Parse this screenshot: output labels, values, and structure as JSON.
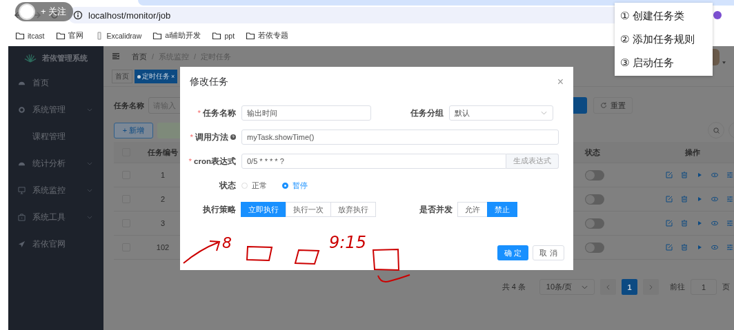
{
  "browser": {
    "url": "localhost/monitor/job",
    "bookmarks": [
      {
        "label": "itcast",
        "kind": "folder"
      },
      {
        "label": "官网",
        "kind": "folder"
      },
      {
        "label": "Excalidraw",
        "kind": "page"
      },
      {
        "label": "ai辅助开发",
        "kind": "folder"
      },
      {
        "label": "ppt",
        "kind": "folder"
      },
      {
        "label": "若依专题",
        "kind": "folder"
      }
    ]
  },
  "follow_badge": {
    "label": "+ 关注"
  },
  "popup_menu": {
    "items": [
      "① 创建任务类",
      "② 添加任务规则",
      "③ 启动任务"
    ]
  },
  "sidebar": {
    "title": "若依管理系统",
    "items": [
      {
        "label": "首页",
        "kind": "link"
      },
      {
        "label": "系统管理",
        "kind": "submenu",
        "children": [
          {
            "label": "课程管理"
          }
        ]
      },
      {
        "label": "统计分析",
        "kind": "submenu"
      },
      {
        "label": "系统监控",
        "kind": "submenu"
      },
      {
        "label": "系统工具",
        "kind": "submenu"
      },
      {
        "label": "若依官网",
        "kind": "link"
      }
    ]
  },
  "navbar": {
    "breadcrumb": [
      "首页",
      "系统监控",
      "定时任务"
    ],
    "separators": [
      "/",
      "/"
    ]
  },
  "tags": [
    {
      "label": "首页",
      "selected": false
    },
    {
      "label": "定时任务",
      "selected": true,
      "close": "×"
    }
  ],
  "search": {
    "label": "任务名称",
    "placeholder": "请输入",
    "reset": "重置"
  },
  "toolbar": {
    "add": "+ 新增"
  },
  "table": {
    "columns": [
      "任务编号",
      "状态",
      "操作"
    ],
    "all_checked": false,
    "rows": [
      {
        "id": "1",
        "on": false,
        "checked": false
      },
      {
        "id": "2",
        "on": false,
        "checked": false
      },
      {
        "id": "3",
        "on": false,
        "checked": false
      },
      {
        "id": "102",
        "on": false,
        "checked": false
      }
    ]
  },
  "pagination": {
    "total": "共 4 条",
    "page_size": "10条/页",
    "pages": [
      {
        "label": "1",
        "selected": true
      }
    ],
    "goto_label": "前往",
    "goto_value": "1",
    "page_unit": "页"
  },
  "dialog": {
    "title": "修改任务",
    "close": "×",
    "fields": {
      "name": {
        "label": "任务名称",
        "required_mark": "*",
        "value": "输出时间"
      },
      "group": {
        "label": "任务分组",
        "value": "默认"
      },
      "method": {
        "label": "调用方法",
        "required_mark": "*",
        "value": "myTask.showTime()"
      },
      "cron": {
        "label": "cron表达式",
        "required_mark": "*",
        "value": "0/5 * * * * ?",
        "button": "生成表达式"
      },
      "status": {
        "label": "状态",
        "options": [
          {
            "label": "正常",
            "selected": false
          },
          {
            "label": "暂停",
            "selected": true
          }
        ]
      },
      "policy": {
        "label": "执行策略",
        "options": [
          {
            "label": "立即执行",
            "selected": true
          },
          {
            "label": "执行一次",
            "selected": false
          },
          {
            "label": "放弃执行",
            "selected": false
          }
        ]
      },
      "concurrent": {
        "label": "是否并发",
        "options": [
          {
            "label": "允许",
            "selected": false
          },
          {
            "label": "禁止",
            "selected": true
          }
        ]
      }
    },
    "confirm": "确 定",
    "cancel": "取 消"
  },
  "annotations": [
    "8",
    "9:15"
  ]
}
